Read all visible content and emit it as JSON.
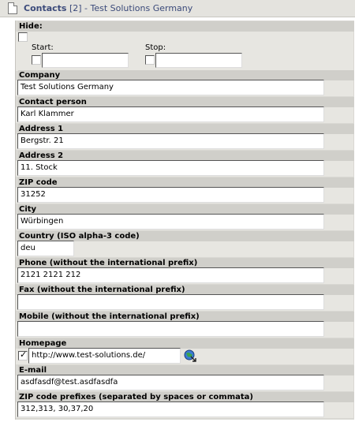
{
  "header": {
    "title_strong": "Contacts",
    "title_rest": " [2] - Test Solutions Germany"
  },
  "hide": {
    "label": "Hide:",
    "start_label": "Start:",
    "stop_label": "Stop:"
  },
  "fields": {
    "company": {
      "label": "Company",
      "value": "Test Solutions Germany"
    },
    "contact": {
      "label": "Contact person",
      "value": "Karl Klammer"
    },
    "address1": {
      "label": "Address 1",
      "value": "Bergstr. 21"
    },
    "address2": {
      "label": "Address 2",
      "value": "11. Stock"
    },
    "zip": {
      "label": "ZIP code",
      "value": "31252"
    },
    "city": {
      "label": "City",
      "value": "Würbingen"
    },
    "country": {
      "label": "Country (ISO alpha-3 code)",
      "value": "deu"
    },
    "phone": {
      "label": "Phone (without the international prefix)",
      "value": "2121 2121 212"
    },
    "fax": {
      "label": "Fax (without the international prefix)",
      "value": ""
    },
    "mobile": {
      "label": "Mobile (without the international prefix)",
      "value": ""
    },
    "homepage": {
      "label": "Homepage",
      "value": "http://www.test-solutions.de/"
    },
    "email": {
      "label": "E-mail",
      "value": "asdfasdf@test.asdfasdfa"
    },
    "zip_prefixes": {
      "label": "ZIP code prefixes (separated by spaces or commata)",
      "value": "312,313, 30,37,20"
    }
  },
  "icons": {
    "document": "document-icon",
    "homepage_link": "globe-link-icon"
  }
}
